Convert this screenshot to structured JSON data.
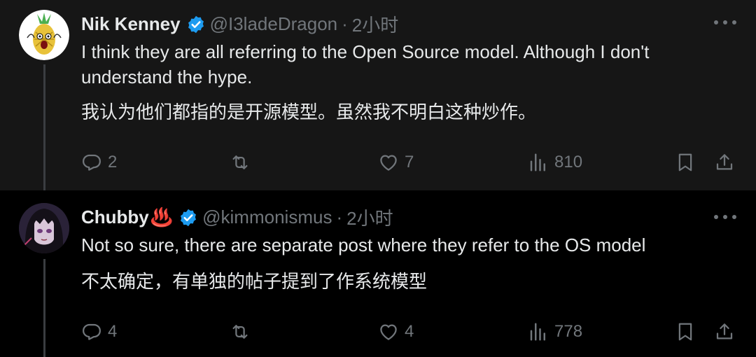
{
  "tweets": [
    {
      "author": {
        "name": "Nik Kenney",
        "name_suffix": "",
        "handle": "@I3ladeDragon",
        "verified": true,
        "avatar_icon": "pineapple-avatar"
      },
      "separator": "·",
      "time": "2小时",
      "text_en": "I think they are all referring to the Open Source model. Although I don't understand the hype.",
      "text_zh": "我认为他们都指的是开源模型。虽然我不明白这种炒作。",
      "stats": {
        "replies": "2",
        "retweets": "",
        "likes": "7",
        "views": "810"
      }
    },
    {
      "author": {
        "name": "Chubby",
        "name_suffix": "♨️",
        "handle": "@kimmonismus",
        "verified": true,
        "avatar_icon": "anime-girl-avatar"
      },
      "separator": "·",
      "time": "2小时",
      "text_en": "Not so sure, there are separate post where they refer to the OS model",
      "text_zh": "不太确定，有单独的帖子提到了作系统模型",
      "stats": {
        "replies": "4",
        "retweets": "",
        "likes": "4",
        "views": "778"
      }
    }
  ],
  "colors": {
    "background_first": "#161616",
    "background_second": "#000000",
    "text": "#e7e9ea",
    "muted": "#71767b",
    "verified": "#1d9bf0"
  },
  "icons": [
    "reply-icon",
    "retweet-icon",
    "like-icon",
    "views-icon",
    "bookmark-icon",
    "share-icon",
    "more-icon",
    "verified-badge-icon"
  ]
}
